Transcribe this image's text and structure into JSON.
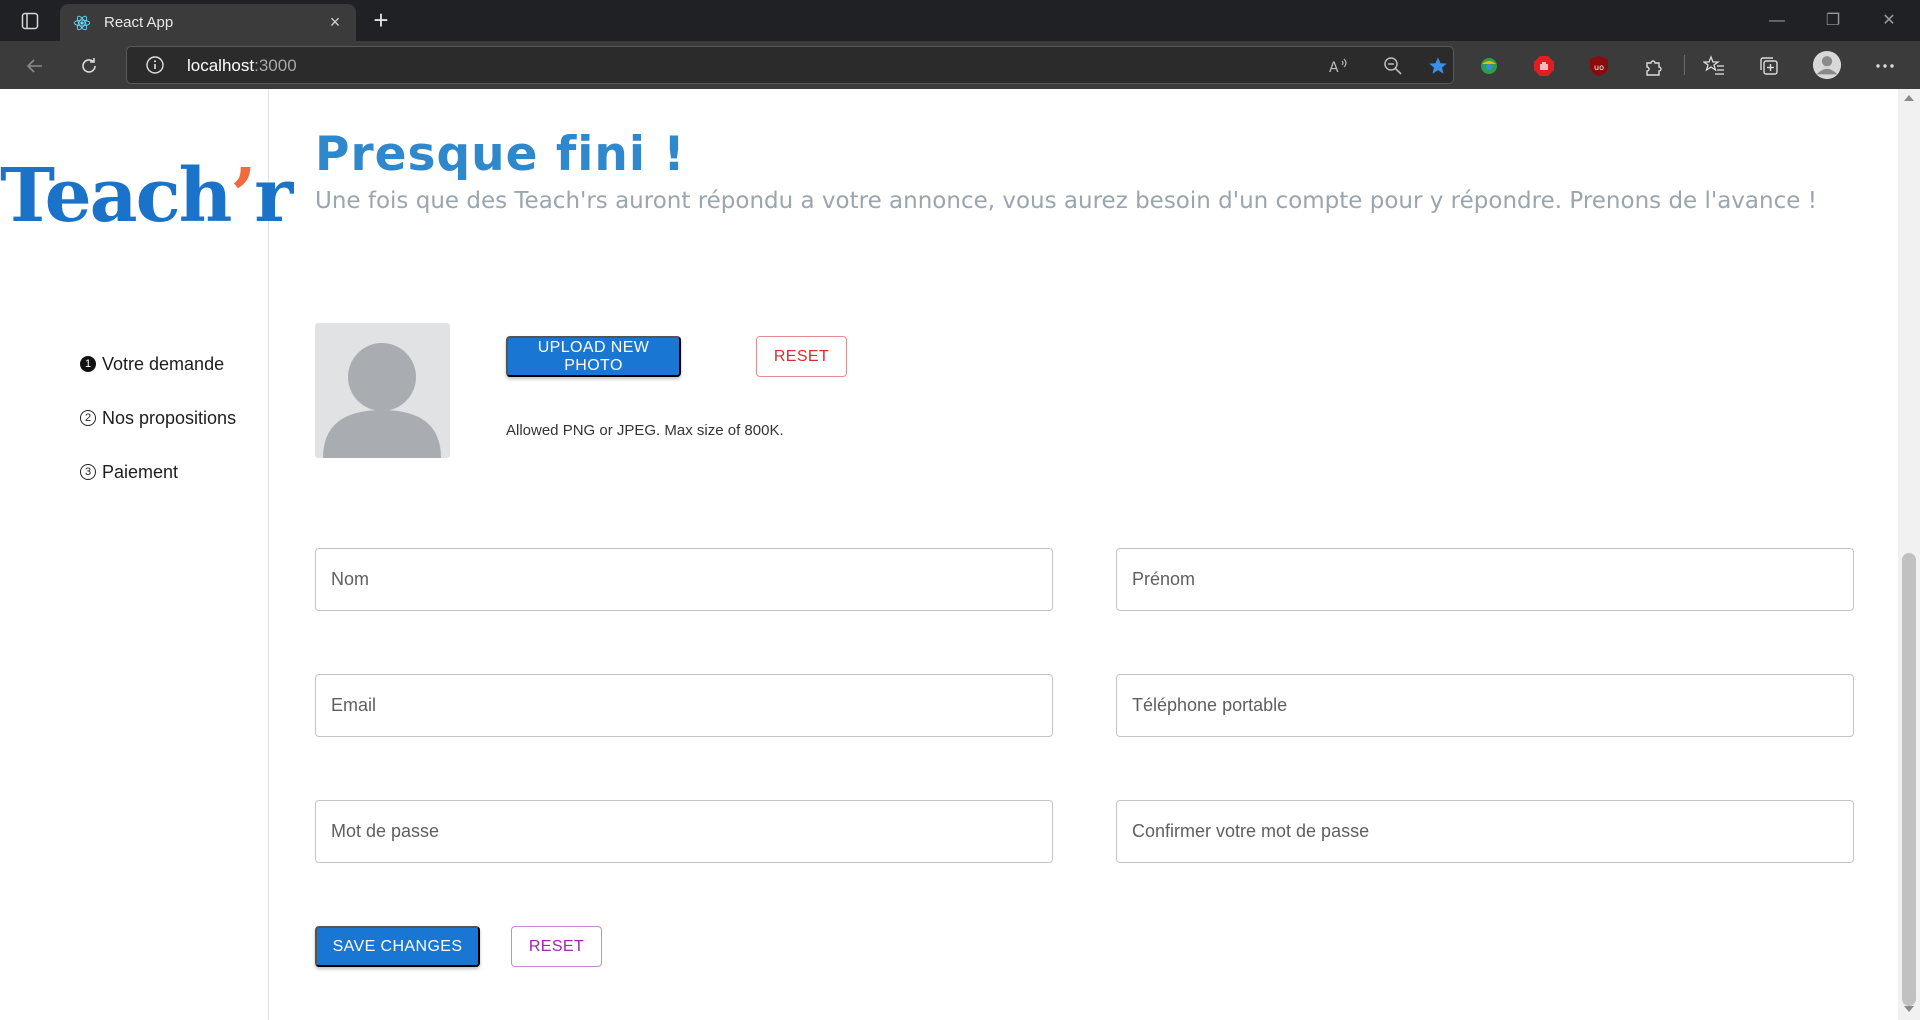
{
  "browser": {
    "tab_title": "React App",
    "new_tab_symbol": "+",
    "close_symbol": "×",
    "address": {
      "host": "localhost",
      "port": ":3000"
    },
    "icons": [
      "tab-actions-icon",
      "react-favicon-icon",
      "back-icon",
      "reload-icon",
      "info-icon",
      "read-aloud-icon",
      "zoom-out-icon",
      "favorite-star-icon",
      "extension-colorful-icon",
      "adblock-icon",
      "ublock-icon",
      "extensions-puzzle-icon",
      "favorites-icon",
      "collections-icon",
      "profile-icon",
      "more-icon"
    ],
    "colors": {
      "titlebar": "#202124",
      "toolbar": "#3b3b3b",
      "star": "#3b8fe8"
    }
  },
  "sidebar": {
    "logo_main": "Teach",
    "logo_apos": "’",
    "logo_tail": "r",
    "steps": [
      {
        "marker": "1",
        "label": "Votre demande"
      },
      {
        "marker": "2",
        "label": "Nos propositions"
      },
      {
        "marker": "3",
        "label": "Paiement"
      }
    ]
  },
  "main": {
    "title": "Presque fini !",
    "subtitle": "Une fois que des Teach'rs auront répondu a votre annonce, vous aurez besoin d'un compte pour y répondre. Prenons de l'avance !",
    "photo": {
      "upload_label": "Upload New Photo",
      "reset_label": "Reset",
      "hint": "Allowed PNG or JPEG. Max size of 800K."
    },
    "form": {
      "nom": "Nom",
      "prenom": "Prénom",
      "email": "Email",
      "telephone": "Téléphone portable",
      "password": "Mot de passe",
      "password_confirm": "Confirmer votre mot de passe"
    },
    "actions": {
      "save_label": "Save Changes",
      "reset_label": "Reset"
    }
  },
  "colors": {
    "brand_blue": "#1a73c8",
    "accent_orange": "#f06a3c",
    "title_blue": "#2f87cc",
    "primary_button": "#1976d2",
    "reset_red": "#d32f2f",
    "reset_purple": "#9c27b0"
  }
}
